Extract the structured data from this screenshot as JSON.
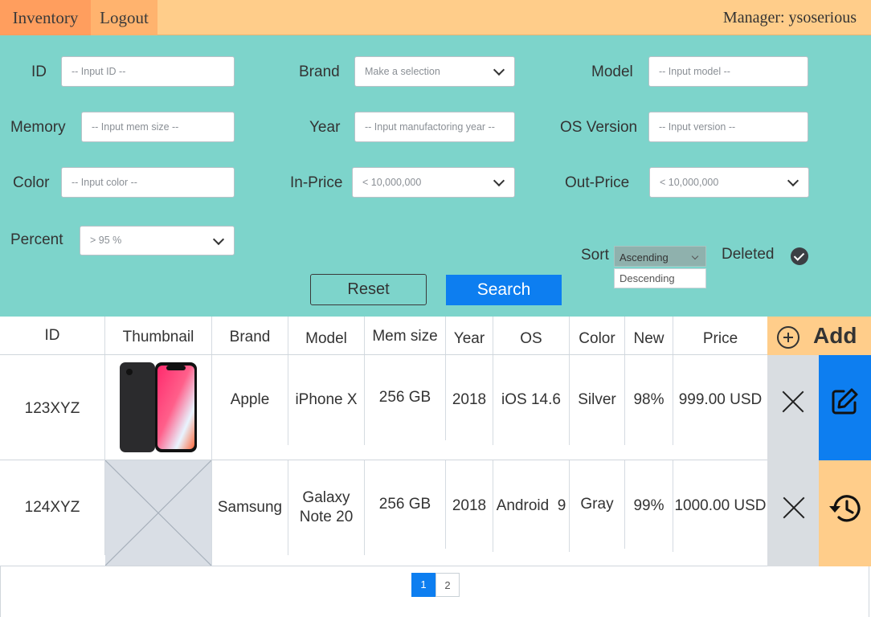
{
  "nav": {
    "inventory": "Inventory",
    "logout": "Logout",
    "manager": "Manager: ysoserious"
  },
  "filters": {
    "id": {
      "label": "ID",
      "placeholder": "-- Input ID --"
    },
    "brand": {
      "label": "Brand",
      "value": "Make a selection"
    },
    "model": {
      "label": "Model",
      "placeholder": "-- Input model --"
    },
    "memory": {
      "label": "Memory",
      "placeholder": "-- Input mem size --"
    },
    "year": {
      "label": "Year",
      "placeholder": "-- Input manufactoring year --"
    },
    "os": {
      "label": "OS Version",
      "placeholder": "-- Input version --"
    },
    "color": {
      "label": "Color",
      "placeholder": "-- Input color --"
    },
    "in_price": {
      "label": "In-Price",
      "value": "< 10,000,000"
    },
    "out_price": {
      "label": "Out-Price",
      "value": "< 10,000,000"
    },
    "percent": {
      "label": "Percent",
      "value": "> 95 %"
    },
    "sort": {
      "label": "Sort",
      "value": "Ascending",
      "option": "Descending"
    },
    "deleted": {
      "label": "Deleted",
      "checked": true
    },
    "reset": "Reset",
    "search": "Search"
  },
  "table": {
    "headers": [
      "ID",
      "Thumbnail",
      "Brand",
      "Model",
      "Mem size",
      "Year",
      "OS",
      "Color",
      "New",
      "Price"
    ],
    "add": "Add",
    "rows": [
      {
        "id": "123XYZ",
        "thumbnail": "phone-image",
        "brand": "Apple",
        "model": "iPhone X",
        "mem": "256 GB",
        "year": "2018",
        "os": "iOS 14.6",
        "color": "Silver",
        "new": "98%",
        "price": "999.00 USD",
        "action": "edit-icon"
      },
      {
        "id": "124XYZ",
        "thumbnail": "placeholder-image",
        "brand": "Samsung",
        "model": "Galaxy Note 20",
        "mem": "256 GB",
        "year": "2018",
        "os": "Android  9",
        "color": "Gray",
        "new": "99%",
        "price": "1000.00 USD",
        "action": "restore-history-icon"
      }
    ]
  },
  "pager": {
    "pages": [
      "1",
      "2"
    ],
    "current": "1"
  },
  "colors": {
    "topbar": "#ffcd8a",
    "active_tab": "#ff9e5e",
    "panel": "#7dd4cb",
    "primary": "#0d7ef0",
    "restore": "#ffcd8a"
  }
}
